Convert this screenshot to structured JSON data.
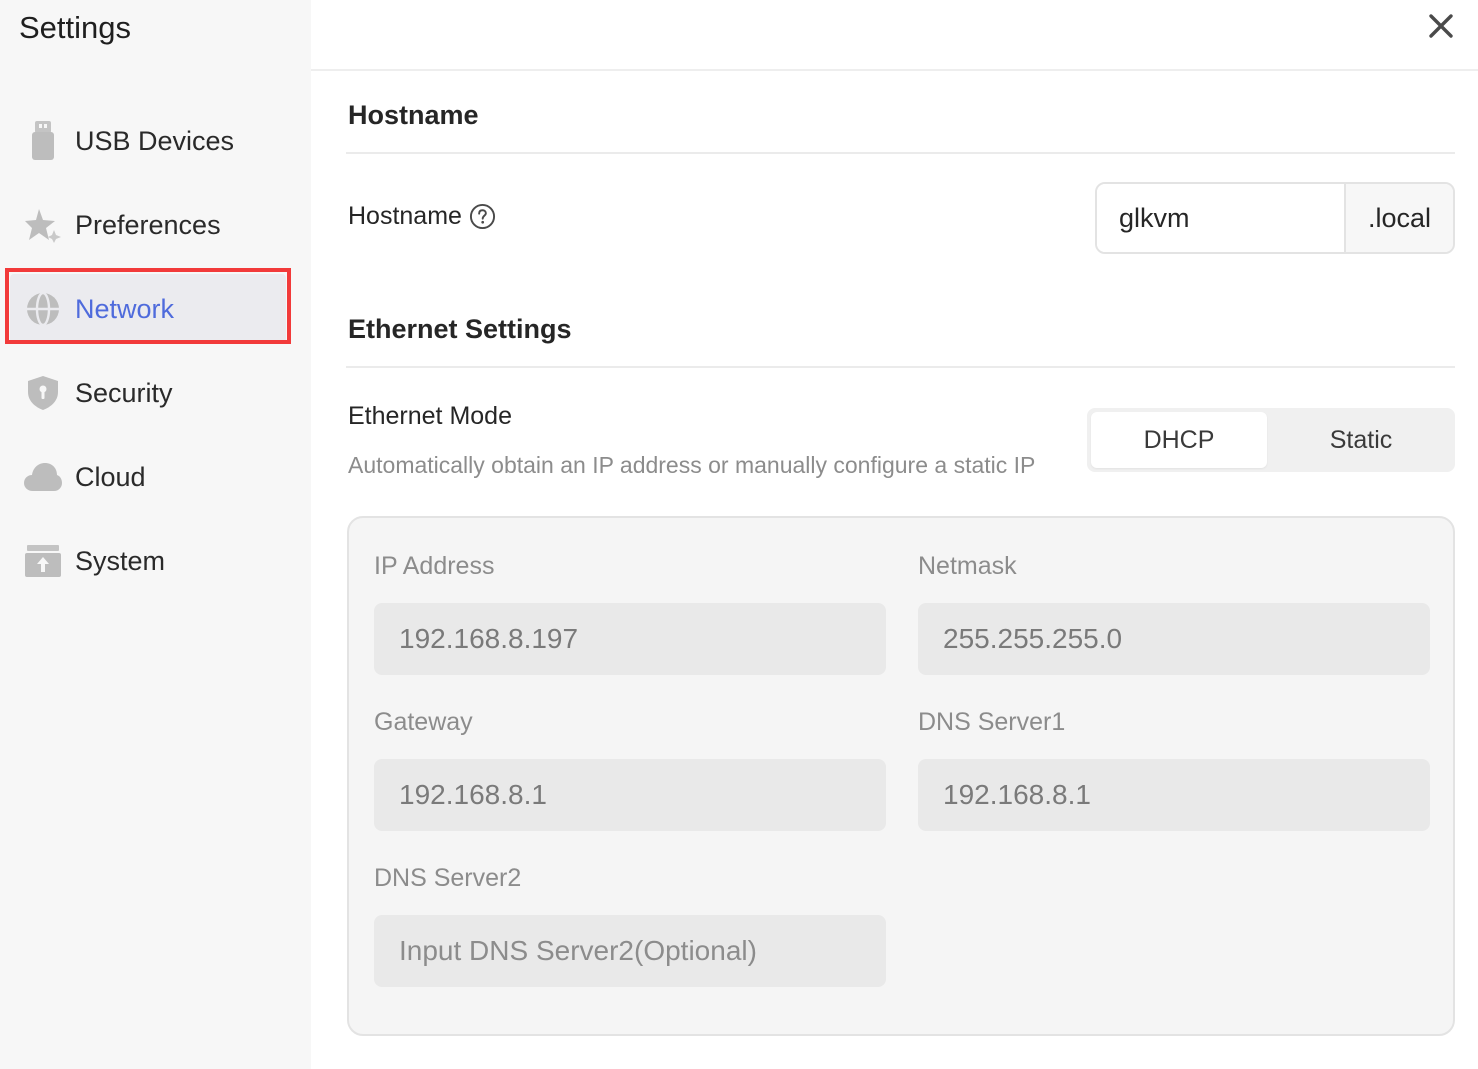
{
  "app": {
    "title": "Settings"
  },
  "sidebar": {
    "items": [
      {
        "label": "USB Devices",
        "icon": "usb-drive-icon",
        "active": false
      },
      {
        "label": "Preferences",
        "icon": "sparkle-icon",
        "active": false
      },
      {
        "label": "Network",
        "icon": "globe-icon",
        "active": true
      },
      {
        "label": "Security",
        "icon": "shield-icon",
        "active": false
      },
      {
        "label": "Cloud",
        "icon": "cloud-icon",
        "active": false
      },
      {
        "label": "System",
        "icon": "system-box-icon",
        "active": false
      }
    ]
  },
  "hostname_section": {
    "title": "Hostname",
    "field_label": "Hostname",
    "value": "glkvm",
    "suffix": ".local"
  },
  "ethernet_section": {
    "title": "Ethernet Settings",
    "mode_label": "Ethernet Mode",
    "mode_description": "Automatically obtain an IP address or manually configure a static IP",
    "modes": [
      {
        "label": "DHCP",
        "selected": true
      },
      {
        "label": "Static",
        "selected": false
      }
    ],
    "fields": {
      "ip_address": {
        "label": "IP Address",
        "value": "192.168.8.197"
      },
      "netmask": {
        "label": "Netmask",
        "value": "255.255.255.0"
      },
      "gateway": {
        "label": "Gateway",
        "value": "192.168.8.1"
      },
      "dns1": {
        "label": "DNS Server1",
        "value": "192.168.8.1"
      },
      "dns2": {
        "label": "DNS Server2",
        "value": "",
        "placeholder": "Input DNS Server2(Optional)"
      }
    }
  },
  "colors": {
    "accent": "#4f6bdc",
    "highlight_border": "#f23a3a",
    "sidebar_bg": "#f7f7f7",
    "icon_gray": "#bdbdbd"
  }
}
